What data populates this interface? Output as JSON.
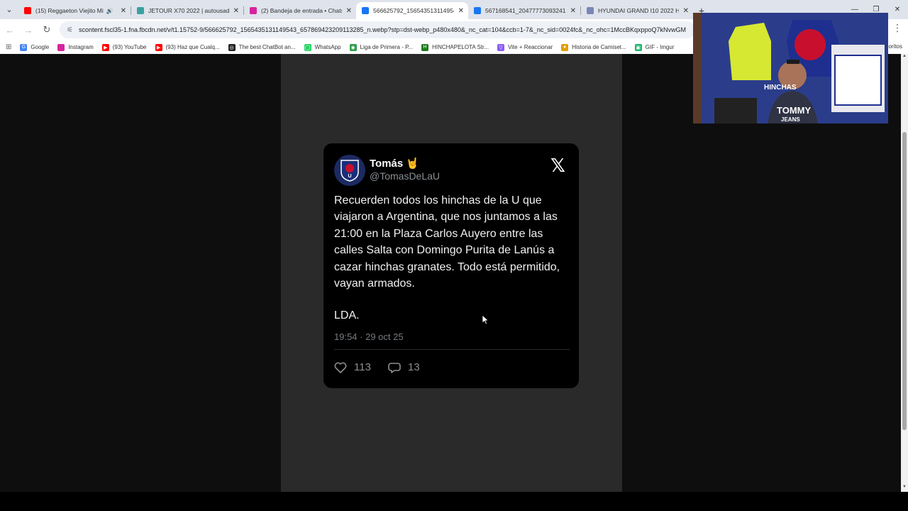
{
  "browser": {
    "tabs": [
      {
        "title": "(15) Reggaeton Viejito Mix",
        "icon": "youtube-icon",
        "color": "#ff0000",
        "audio": true,
        "active": false
      },
      {
        "title": "JETOUR X70 2022 | autousado",
        "icon": "site-icon",
        "color": "#3aa0a0",
        "audio": false,
        "active": false
      },
      {
        "title": "(2) Bandeja de entrada • Chats",
        "icon": "instagram-icon",
        "color": "#d6249f",
        "audio": false,
        "active": false
      },
      {
        "title": "566625792_15654351311495433",
        "icon": "facebook-icon",
        "color": "#1877f2",
        "audio": false,
        "active": true
      },
      {
        "title": "567168541_20477773093241243",
        "icon": "facebook-icon",
        "color": "#1877f2",
        "audio": false,
        "active": false
      },
      {
        "title": "HYUNDAI GRAND I10 2022 HB",
        "icon": "car-icon",
        "color": "#7a86b8",
        "audio": false,
        "active": false
      }
    ],
    "url": "scontent.fscl35-1.fna.fbcdn.net/v/t1.15752-9/566625792_1565435131149543_6578694232091132­85_n.webp?stp=dst-webp_p480x480&_nc_cat=104&ccb=1-7&_nc_sid=0024fc&_nc_ohc=1MccBKqxppoQ7kNvwGM",
    "bookmarks": [
      {
        "label": "Google",
        "color": "#4285f4",
        "glyph": "G"
      },
      {
        "label": "Instagram",
        "color": "#d6249f",
        "glyph": ""
      },
      {
        "label": "(93) YouTube",
        "color": "#ff0000",
        "glyph": "▶"
      },
      {
        "label": "(93) Haz que Cualq...",
        "color": "#ff0000",
        "glyph": "▶"
      },
      {
        "label": "The best ChatBot an...",
        "color": "#222222",
        "glyph": "◎"
      },
      {
        "label": "WhatsApp",
        "color": "#25d366",
        "glyph": "◯"
      },
      {
        "label": "Liga de Primera - P...",
        "color": "#2e9c4a",
        "glyph": "◉"
      },
      {
        "label": "HINCHAPELOTA Str...",
        "color": "#1b7a1b",
        "glyph": "H"
      },
      {
        "label": "Vite + Reaccionar",
        "color": "#8a5cf6",
        "glyph": "▽"
      },
      {
        "label": "Historia de Camiset...",
        "color": "#e0a000",
        "glyph": "♦"
      },
      {
        "label": "GIF - Imgur",
        "color": "#1bb76e",
        "glyph": "▣"
      }
    ],
    "bookmarks_tail": "oritos"
  },
  "tweet": {
    "name": "Tomás 🤘",
    "handle": "@TomasDeLaU",
    "text": "Recuerden todos los hinchas de la U que viajaron a Argentina, que nos juntamos a las 21:00 en la Plaza Carlos Auyero entre las calles Salta  con Domingo Purita de Lanús a cazar hinchas granates. Todo está permitido, vayan armados.",
    "signature": "LDA.",
    "timestamp": "19:54 · 29 oct 25",
    "likes": "113",
    "replies": "13"
  },
  "webcam": {
    "shirt_text_1": "TOMMY",
    "shirt_text_2": "JEANS",
    "banner_text": "HINCHAS"
  },
  "colors": {
    "page_bg": "#0e0e0e",
    "image_bg": "#2a2a2a",
    "tweet_bg": "#000000",
    "accent": "#1877f2"
  }
}
